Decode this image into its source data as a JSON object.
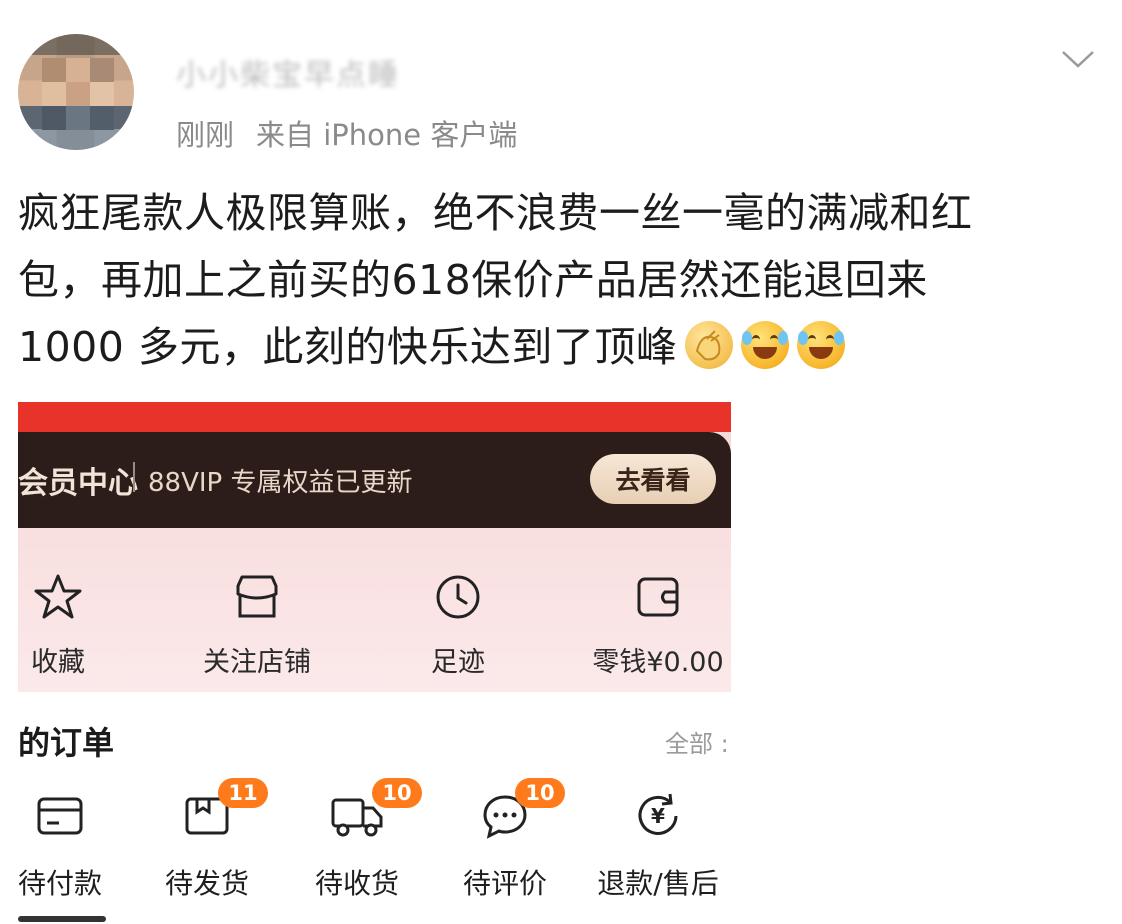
{
  "post": {
    "username": "小小柴宝早点睡",
    "time": "刚刚",
    "source": "来自 iPhone 客户端",
    "text_lines": [
      "疯狂尾款人极限算账，绝不浪费一丝一毫的满减和红",
      "包，再加上之前买的618保价产品居然还能退回来",
      "1000 多元，此刻的快乐达到了顶峰"
    ],
    "emojis": [
      "clap-emoji",
      "laugh-cry-emoji",
      "laugh-cry-emoji"
    ]
  },
  "screenshot": {
    "vip": {
      "title": "会员中心",
      "text": "88VIP 专属权益已更新",
      "button": "去看看"
    },
    "quick_items": [
      {
        "label": "收藏",
        "icon": "star-icon"
      },
      {
        "label": "关注店铺",
        "icon": "store-icon"
      },
      {
        "label": "足迹",
        "icon": "clock-icon"
      },
      {
        "label": "零钱¥0.00",
        "icon": "wallet-icon"
      }
    ],
    "orders": {
      "title": "的订单",
      "all": "全部 :",
      "items": [
        {
          "label": "待付款",
          "icon": "card-icon",
          "badge": ""
        },
        {
          "label": "待发货",
          "icon": "package-icon",
          "badge": "11"
        },
        {
          "label": "待收货",
          "icon": "truck-icon",
          "badge": "10"
        },
        {
          "label": "待评价",
          "icon": "comment-icon",
          "badge": "10"
        },
        {
          "label": "退款/售后",
          "icon": "refund-icon",
          "badge": ""
        }
      ]
    }
  },
  "colors": {
    "red": "#e8332a",
    "vip_dark": "#2d1d1a",
    "badge": "#ff7a1a",
    "meta_gray": "#8a8a8a"
  }
}
